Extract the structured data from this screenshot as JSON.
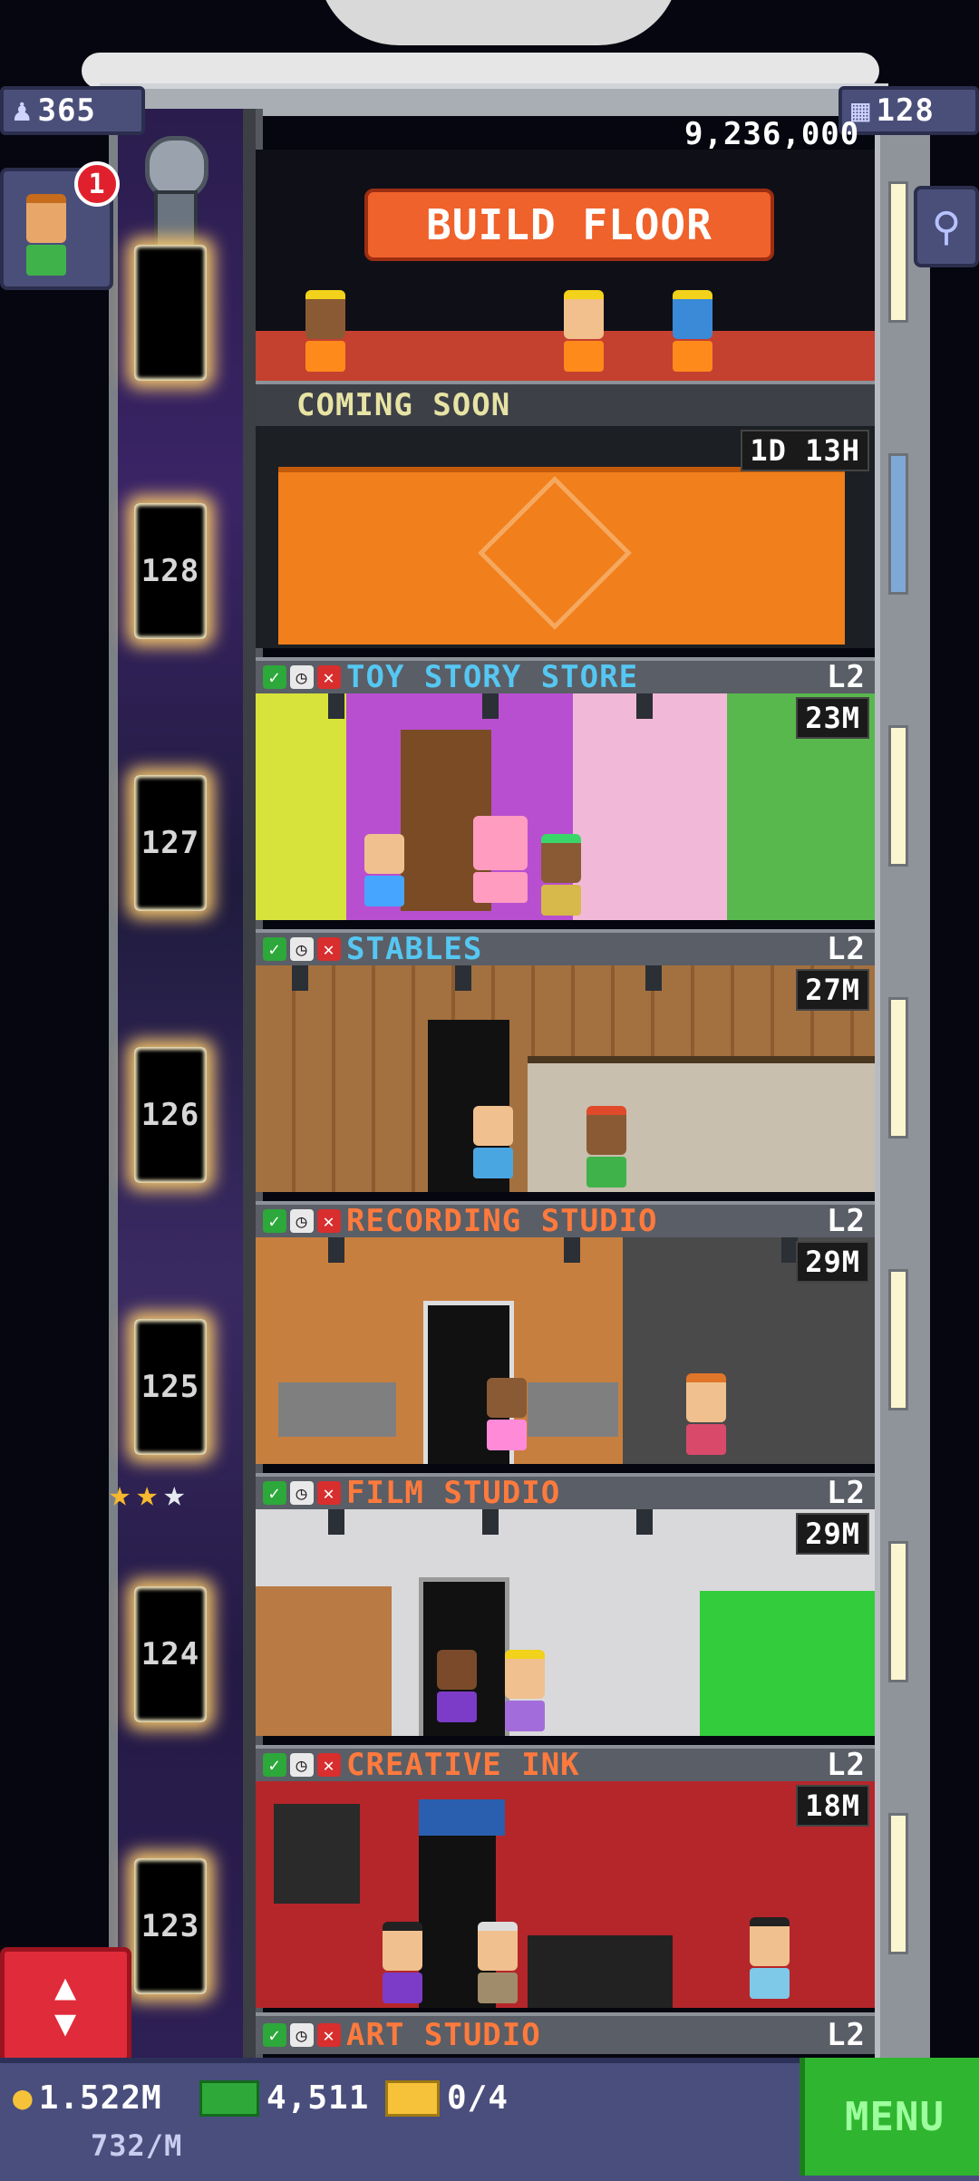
{
  "top": {
    "population": "365",
    "floors_count": "128",
    "coins_total": "9,236,000",
    "notification_badge": "1"
  },
  "build": {
    "button_label": "BUILD FLOOR",
    "coming_soon": "COMING SOON",
    "construction_timer": "1D 13H"
  },
  "floors": [
    {
      "number": "128",
      "name": "TOY STORY STORE",
      "level": "L2",
      "timer": "23M",
      "label_color": "blue"
    },
    {
      "number": "127",
      "name": "STABLES",
      "level": "L2",
      "timer": "27M",
      "label_color": "blue"
    },
    {
      "number": "126",
      "name": "RECORDING STUDIO",
      "level": "L2",
      "timer": "29M",
      "label_color": "orange"
    },
    {
      "number": "125",
      "name": "FILM STUDIO",
      "level": "L2",
      "timer": "29M",
      "label_color": "orange"
    },
    {
      "number": "124",
      "name": "CREATIVE INK",
      "level": "L2",
      "timer": "18M",
      "label_color": "orange"
    },
    {
      "number": "123",
      "name": "ART STUDIO",
      "level": "L2",
      "timer": "",
      "label_color": "orange"
    }
  ],
  "bottom": {
    "coins": "1.522M",
    "coins_rate": "732/M",
    "bux": "4,511",
    "tickets": "0/4",
    "menu_label": "MENU"
  },
  "colors": {
    "orange_label": "#ff7a3c",
    "blue_label": "#55c7f2",
    "menu_green": "#2fb52f",
    "elevator_red": "#e02b3a"
  },
  "icons": [
    "population-icon",
    "floors-icon",
    "search-icon",
    "coin-icon",
    "bux-icon",
    "ticket-icon",
    "star-icon",
    "elevator-icon"
  ]
}
